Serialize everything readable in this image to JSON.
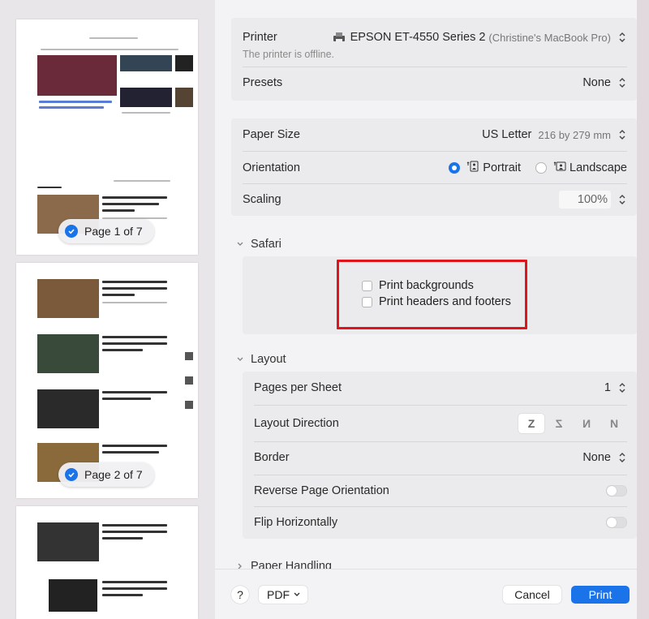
{
  "preview": {
    "pages": [
      {
        "pill": "Page 1 of 7"
      },
      {
        "pill": "Page 2 of 7"
      }
    ]
  },
  "printer": {
    "label": "Printer",
    "value": "EPSON ET-4550 Series 2",
    "owner": "(Christine's MacBook Pro)",
    "status": "The printer is offline."
  },
  "presets": {
    "label": "Presets",
    "value": "None"
  },
  "paper": {
    "label": "Paper Size",
    "value": "US Letter",
    "dims": "216 by 279 mm"
  },
  "orientation": {
    "label": "Orientation",
    "portrait": "Portrait",
    "landscape": "Landscape",
    "selected": "portrait"
  },
  "scaling": {
    "label": "Scaling",
    "value": "100%"
  },
  "safari": {
    "title": "Safari",
    "print_backgrounds": "Print backgrounds",
    "print_headers": "Print headers and footers"
  },
  "layout": {
    "title": "Layout",
    "pages_per_sheet": {
      "label": "Pages per Sheet",
      "value": "1"
    },
    "direction": {
      "label": "Layout Direction",
      "options": [
        "Z",
        "Z",
        "N",
        "N"
      ]
    },
    "border": {
      "label": "Border",
      "value": "None"
    },
    "reverse": {
      "label": "Reverse Page Orientation"
    },
    "flip": {
      "label": "Flip Horizontally"
    }
  },
  "paper_handling": {
    "title": "Paper Handling"
  },
  "footer": {
    "help": "?",
    "pdf": "PDF",
    "cancel": "Cancel",
    "print": "Print"
  },
  "colors": {
    "accent": "#1a73e8",
    "highlight": "#e0151b"
  }
}
